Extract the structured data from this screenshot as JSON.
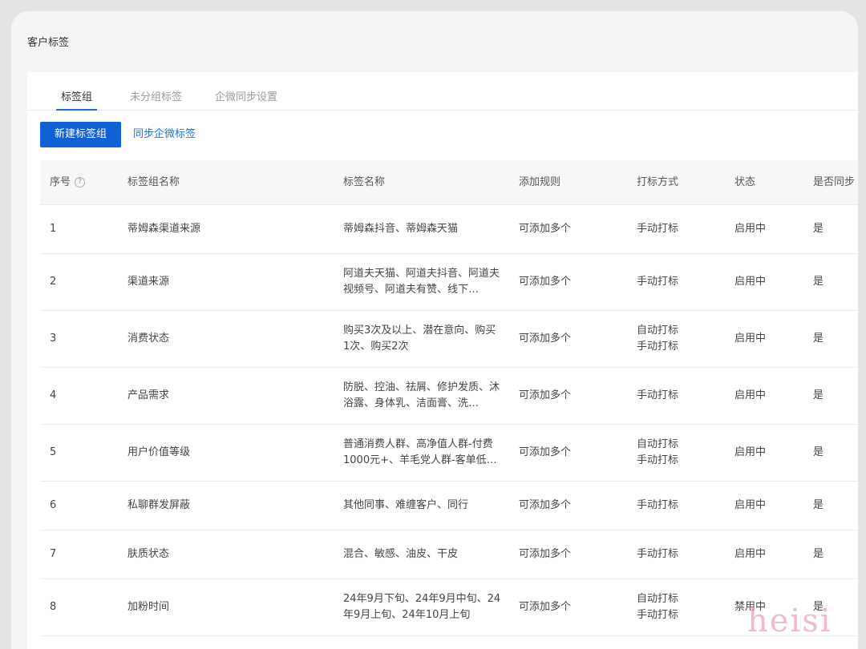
{
  "page": {
    "title": "客户标签"
  },
  "tabs": [
    {
      "label": "标签组",
      "active": true
    },
    {
      "label": "未分组标签",
      "active": false
    },
    {
      "label": "企微同步设置",
      "active": false
    }
  ],
  "actions": {
    "new_group": "新建标签组",
    "sync_wecom": "同步企微标签"
  },
  "table": {
    "headers": {
      "seq": "序号",
      "group": "标签组名称",
      "tags": "标签名称",
      "rule": "添加规则",
      "mode": "打标方式",
      "state": "状态",
      "sync": "是否同步"
    },
    "help_icon": "question-circle-icon",
    "rows": [
      {
        "seq": "1",
        "group": "蒂姆森渠道来源",
        "tags": "蒂姆森抖音、蒂姆森天猫",
        "rule": "可添加多个",
        "mode": [
          "手动打标"
        ],
        "state": "启用中",
        "sync": "是"
      },
      {
        "seq": "2",
        "group": "渠道来源",
        "tags": "阿道夫天猫、阿道夫抖音、阿道夫视频号、阿道夫有赞、线下…",
        "rule": "可添加多个",
        "mode": [
          "手动打标"
        ],
        "state": "启用中",
        "sync": "是"
      },
      {
        "seq": "3",
        "group": "消费状态",
        "tags": "购买3次及以上、潜在意向、购买1次、购买2次",
        "rule": "可添加多个",
        "mode": [
          "自动打标",
          "手动打标"
        ],
        "state": "启用中",
        "sync": "是"
      },
      {
        "seq": "4",
        "group": "产品需求",
        "tags": "防脱、控油、祛屑、修护发质、沐浴露、身体乳、洁面膏、洗…",
        "rule": "可添加多个",
        "mode": [
          "手动打标"
        ],
        "state": "启用中",
        "sync": "是"
      },
      {
        "seq": "5",
        "group": "用户价值等级",
        "tags": "普通消费人群、高净值人群-付费1000元+、羊毛党人群-客单低…",
        "rule": "可添加多个",
        "mode": [
          "自动打标",
          "手动打标"
        ],
        "state": "启用中",
        "sync": "是"
      },
      {
        "seq": "6",
        "group": "私聊群发屏蔽",
        "tags": "其他同事、难缠客户、同行",
        "rule": "可添加多个",
        "mode": [
          "手动打标"
        ],
        "state": "启用中",
        "sync": "是"
      },
      {
        "seq": "7",
        "group": "肤质状态",
        "tags": "混合、敏感、油皮、干皮",
        "rule": "可添加多个",
        "mode": [
          "手动打标"
        ],
        "state": "启用中",
        "sync": "是"
      },
      {
        "seq": "8",
        "group": "加粉时间",
        "tags": "24年9月下旬、24年9月中旬、24年9月上旬、24年10月上旬",
        "rule": "可添加多个",
        "mode": [
          "自动打标",
          "手动打标"
        ],
        "state": "禁用中",
        "sync": "是"
      }
    ]
  },
  "watermark": "heisi"
}
